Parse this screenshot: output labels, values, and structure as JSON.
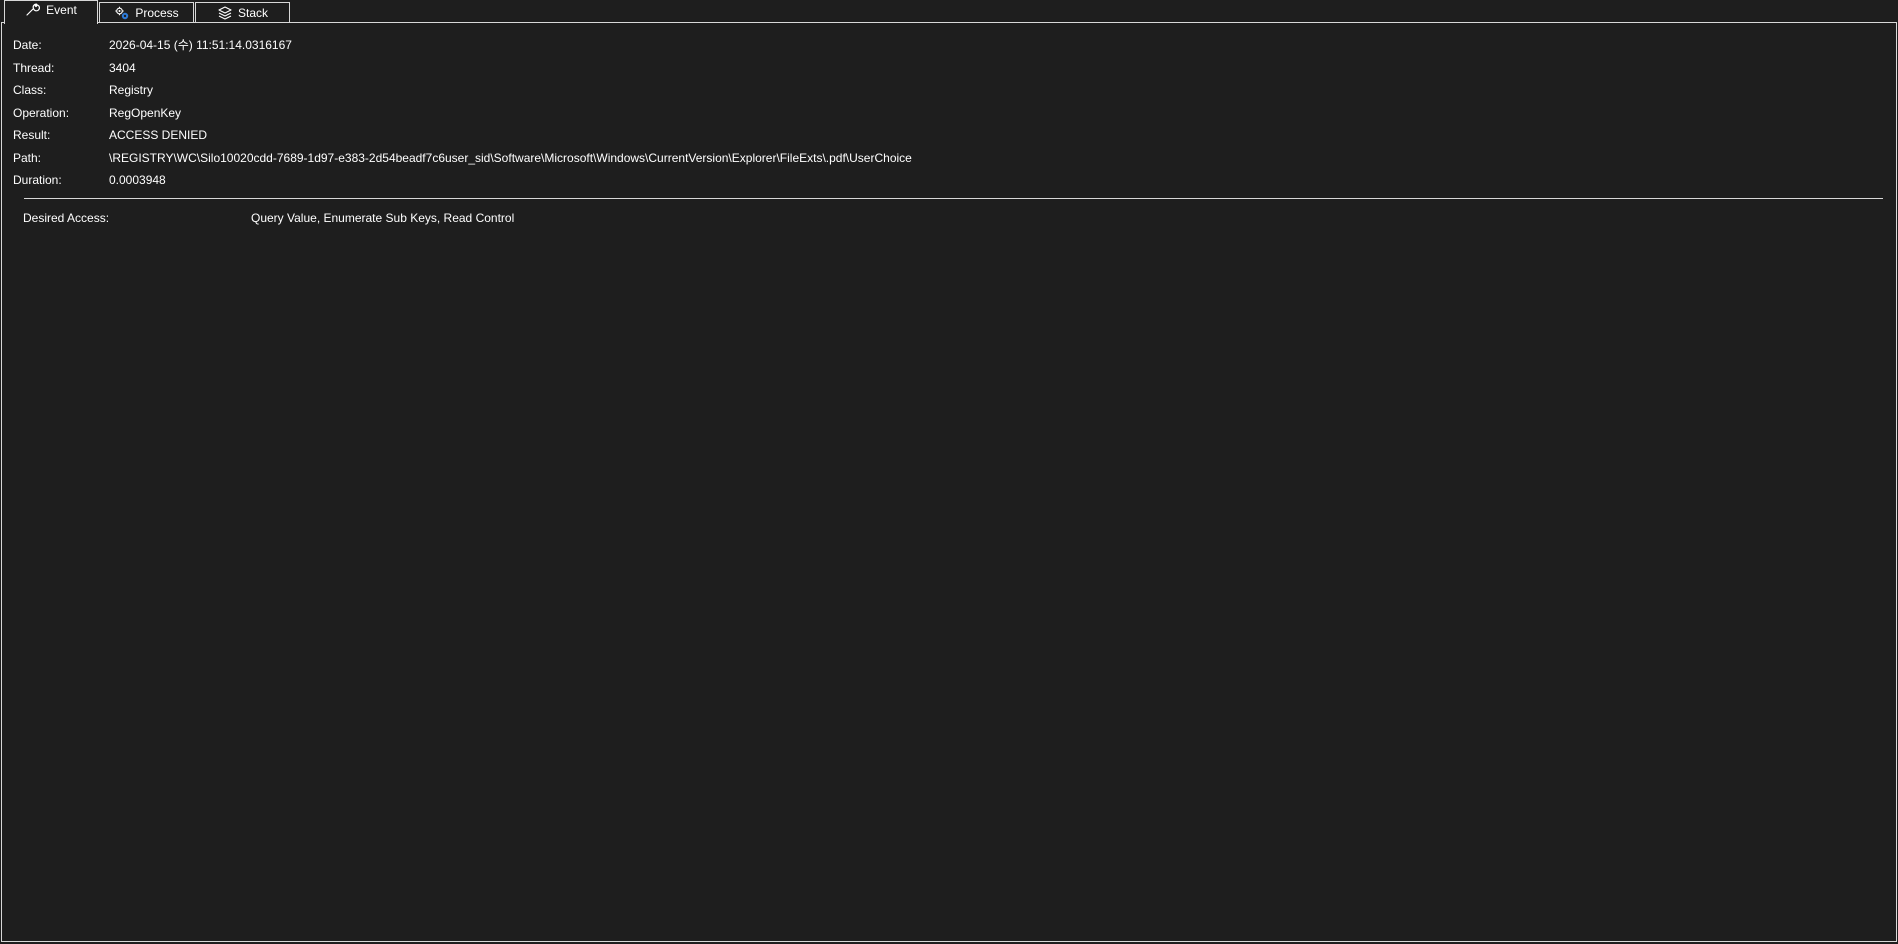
{
  "tabs": {
    "event": {
      "label": "Event",
      "icon": "wrench-icon"
    },
    "process": {
      "label": "Process",
      "icon": "process-gears-icon"
    },
    "stack": {
      "label": "Stack",
      "icon": "stack-layers-icon"
    }
  },
  "event": {
    "fields": [
      {
        "label": "Date:",
        "value": "2026-04-15 (수) 11:51:14.0316167"
      },
      {
        "label": "Thread:",
        "value": "3404"
      },
      {
        "label": "Class:",
        "value": "Registry"
      },
      {
        "label": "Operation:",
        "value": "RegOpenKey"
      },
      {
        "label": "Result:",
        "value": "ACCESS DENIED"
      },
      {
        "label": "Path:",
        "value": "\\REGISTRY\\WC\\Silo10020cdd-7689-1d97-e383-2d54beadf7c6user_sid\\Software\\Microsoft\\Windows\\CurrentVersion\\Explorer\\FileExts\\.pdf\\UserChoice"
      },
      {
        "label": "Duration:",
        "value": "0.0003948"
      }
    ],
    "details": [
      {
        "label": "Desired Access:",
        "value": "Query Value, Enumerate Sub Keys, Read Control"
      }
    ]
  },
  "colors": {
    "background": "#1e1e1e",
    "text": "#ffffff",
    "border": "#d8d8d8",
    "accent": "#2f7bd8"
  }
}
